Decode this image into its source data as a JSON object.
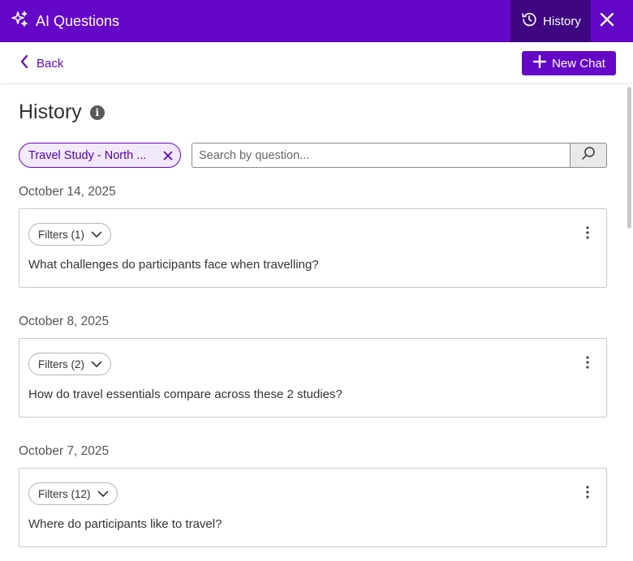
{
  "app": {
    "title": "AI Questions"
  },
  "header": {
    "history_label": "History"
  },
  "subbar": {
    "back_label": "Back",
    "new_chat_label": "New Chat"
  },
  "page": {
    "title": "History"
  },
  "filter_chip": {
    "label": "Travel Study - North ..."
  },
  "search": {
    "placeholder": "Search by question...",
    "value": ""
  },
  "history": [
    {
      "date": "October 14, 2025",
      "filters_label": "Filters (1)",
      "question": "What challenges do participants face when travelling?"
    },
    {
      "date": "October 8, 2025",
      "filters_label": "Filters (2)",
      "question": "How do travel essentials compare across these 2 studies?"
    },
    {
      "date": "October 7, 2025",
      "filters_label": "Filters (12)",
      "question": "Where do participants like to travel?"
    }
  ],
  "colors": {
    "brand": "#6407c7",
    "brand_dark": "#3e0683",
    "chip_bg": "#f2e9fc"
  },
  "icons": {
    "title": "sparkle-icon",
    "history": "history-icon",
    "close": "close-icon",
    "back": "chevron-left-icon",
    "new_chat": "plus-icon",
    "info": "info-icon",
    "chip_remove": "close-icon",
    "search": "search-icon",
    "filters": "chevron-down-icon",
    "menu": "kebab-menu-icon"
  }
}
